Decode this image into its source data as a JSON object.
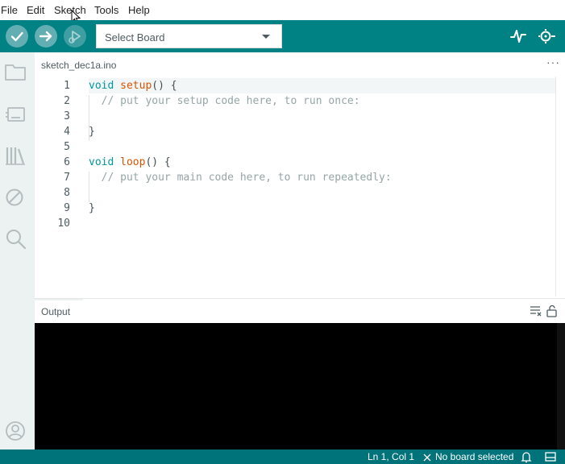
{
  "menu": {
    "items": [
      {
        "label": "File"
      },
      {
        "label": "Edit"
      },
      {
        "label": "Sketch"
      },
      {
        "label": "Tools"
      },
      {
        "label": "Help"
      }
    ]
  },
  "toolbar": {
    "verify_icon": "check-icon",
    "upload_icon": "arrow-right-icon",
    "debug_icon": "debug-play-icon",
    "board_select": {
      "value": "Select Board"
    },
    "plotter_icon": "serial-plotter-icon",
    "monitor_icon": "serial-monitor-icon",
    "accent": "#008184"
  },
  "sidebar": {
    "icons": [
      "folder-icon",
      "board-manager-icon",
      "library-icon",
      "debug-disabled-icon",
      "search-icon",
      "account-icon"
    ]
  },
  "editor": {
    "tab_label": "sketch_dec1a.ino",
    "more_label": "···",
    "line_numbers": [
      "1",
      "2",
      "3",
      "4",
      "5",
      "6",
      "7",
      "8",
      "9",
      "10"
    ]
  },
  "output": {
    "title": "Output"
  },
  "status": {
    "position": "Ln 1, Col 1",
    "board": "No board selected"
  }
}
